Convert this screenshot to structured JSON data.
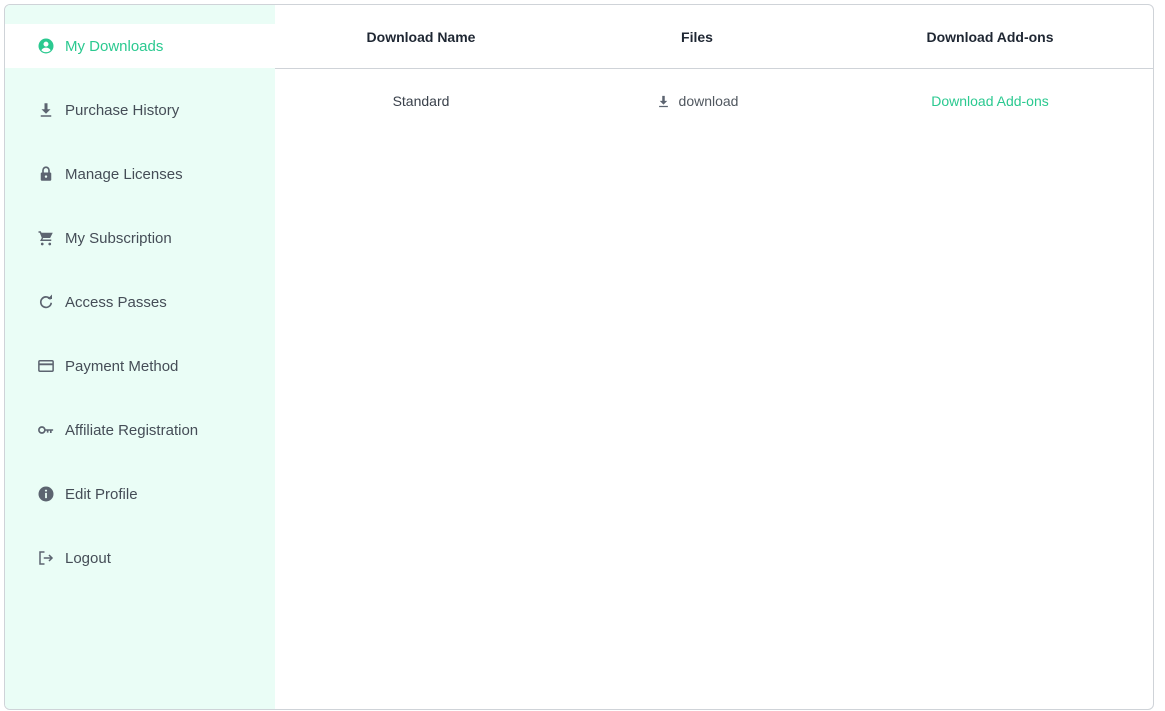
{
  "sidebar": {
    "items": [
      {
        "label": "My Downloads",
        "icon": "account-circle-icon",
        "active": true
      },
      {
        "label": "Purchase History",
        "icon": "download-icon"
      },
      {
        "label": "Manage Licenses",
        "icon": "lock-icon"
      },
      {
        "label": "My Subscription",
        "icon": "cart-icon"
      },
      {
        "label": "Access Passes",
        "icon": "refresh-icon"
      },
      {
        "label": "Payment Method",
        "icon": "credit-card-icon"
      },
      {
        "label": "Affiliate Registration",
        "icon": "key-icon"
      },
      {
        "label": "Edit Profile",
        "icon": "info-icon"
      },
      {
        "label": "Logout",
        "icon": "logout-icon"
      }
    ]
  },
  "table": {
    "headers": [
      "Download Name",
      "Files",
      "Download Add-ons"
    ],
    "rows": [
      {
        "name": "Standard",
        "file_label": "download",
        "addon_label": "Download Add-ons"
      }
    ]
  },
  "colors": {
    "accent": "#2bc990",
    "sidebar_bg": "#eafdf6",
    "text": "#454d57",
    "icon": "#5c6470"
  }
}
